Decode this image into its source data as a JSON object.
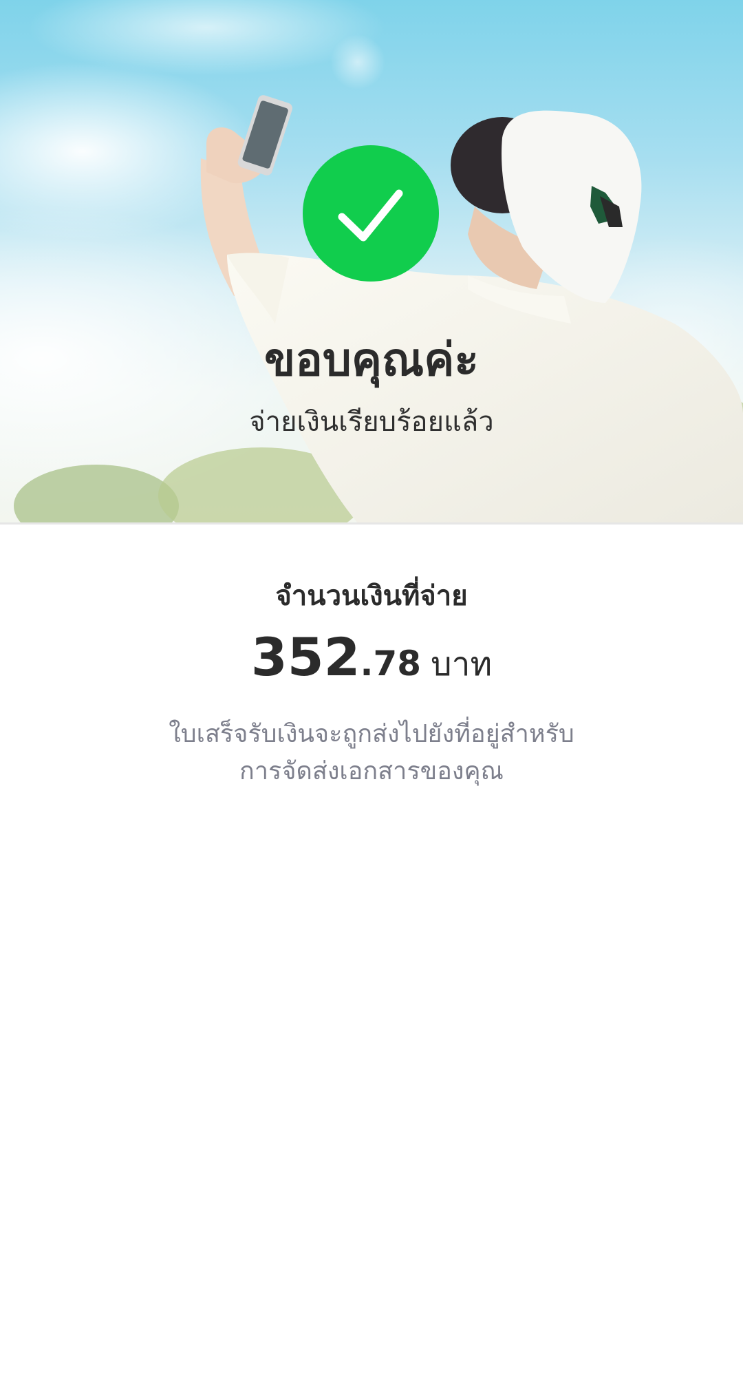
{
  "hero": {
    "title": "ขอบคุณค่ะ",
    "subtitle": "จ่ายเงินเรียบร้อยแล้ว",
    "badge_icon": "checkmark-icon",
    "badge_color": "#11cd4d",
    "photo_icon": "person-taking-selfie-photo"
  },
  "payment": {
    "amount_label": "จำนวนเงินที่จ่าย",
    "amount_integer": "352",
    "amount_decimal": ".78",
    "currency": "บาท"
  },
  "receipt_note": {
    "line1": "ใบเสร็จรับเงินจะถูกส่งไปยังที่อยู่สำหรับ",
    "line2": "การจัดส่งเอกสารของคุณ"
  },
  "colors": {
    "text_primary": "#2b2b2b",
    "text_secondary": "#7d7f8c",
    "accent": "#11cd4d"
  }
}
